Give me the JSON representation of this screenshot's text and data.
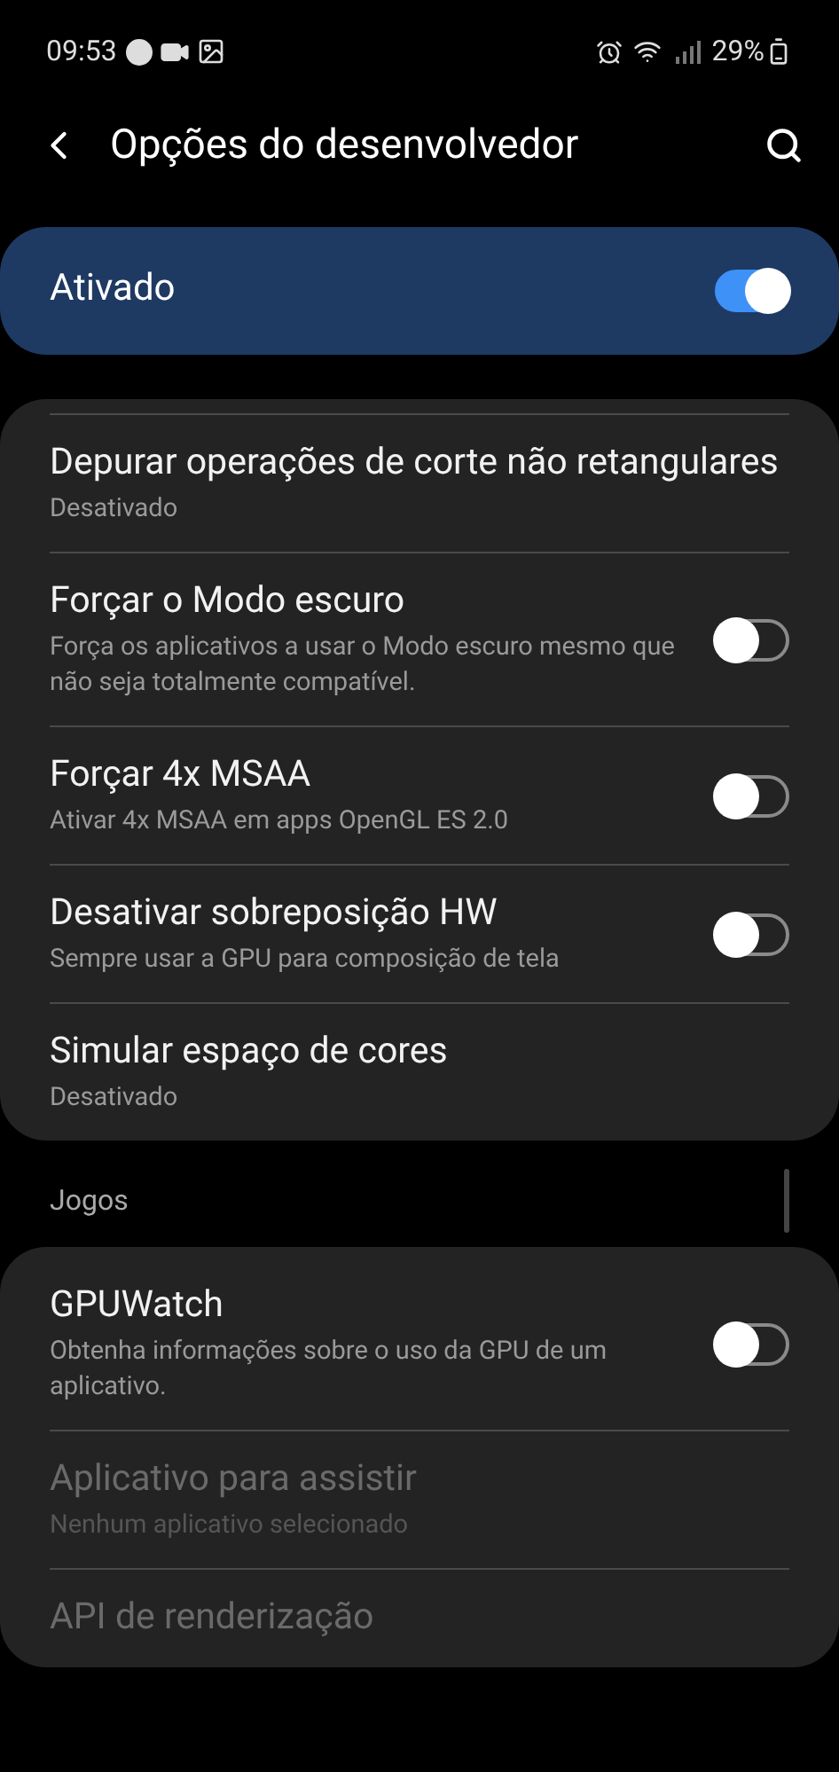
{
  "status_bar": {
    "time": "09:53",
    "battery": "29%"
  },
  "header": {
    "title": "Opções do desenvolvedor"
  },
  "master": {
    "label": "Ativado",
    "on": true
  },
  "sections": [
    {
      "items": [
        {
          "kind": "plain",
          "title": "Depurar operações de corte não retangulares",
          "subtitle": "Desativado",
          "disabled": false
        },
        {
          "kind": "switch",
          "title": "Forçar o Modo escuro",
          "subtitle": "Força os aplicativos a usar o Modo escuro mesmo que não seja totalmente compatível.",
          "on": false,
          "disabled": false
        },
        {
          "kind": "switch",
          "title": "Forçar 4x MSAA",
          "subtitle": "Ativar 4x MSAA em apps OpenGL ES 2.0",
          "on": false,
          "disabled": false
        },
        {
          "kind": "switch",
          "title": "Desativar sobreposição HW",
          "subtitle": "Sempre usar a GPU para composição de tela",
          "on": false,
          "disabled": false
        },
        {
          "kind": "plain",
          "title": "Simular espaço de cores",
          "subtitle": "Desativado",
          "disabled": false
        }
      ]
    },
    {
      "heading": "Jogos",
      "items": [
        {
          "kind": "switch",
          "title": "GPUWatch",
          "subtitle": "Obtenha informações sobre o uso da GPU de um aplicativo.",
          "on": false,
          "disabled": false
        },
        {
          "kind": "plain",
          "title": "Aplicativo para assistir",
          "subtitle": "Nenhum aplicativo selecionado",
          "disabled": true
        },
        {
          "kind": "plain",
          "title": "API de renderização",
          "disabled": true
        }
      ]
    }
  ]
}
